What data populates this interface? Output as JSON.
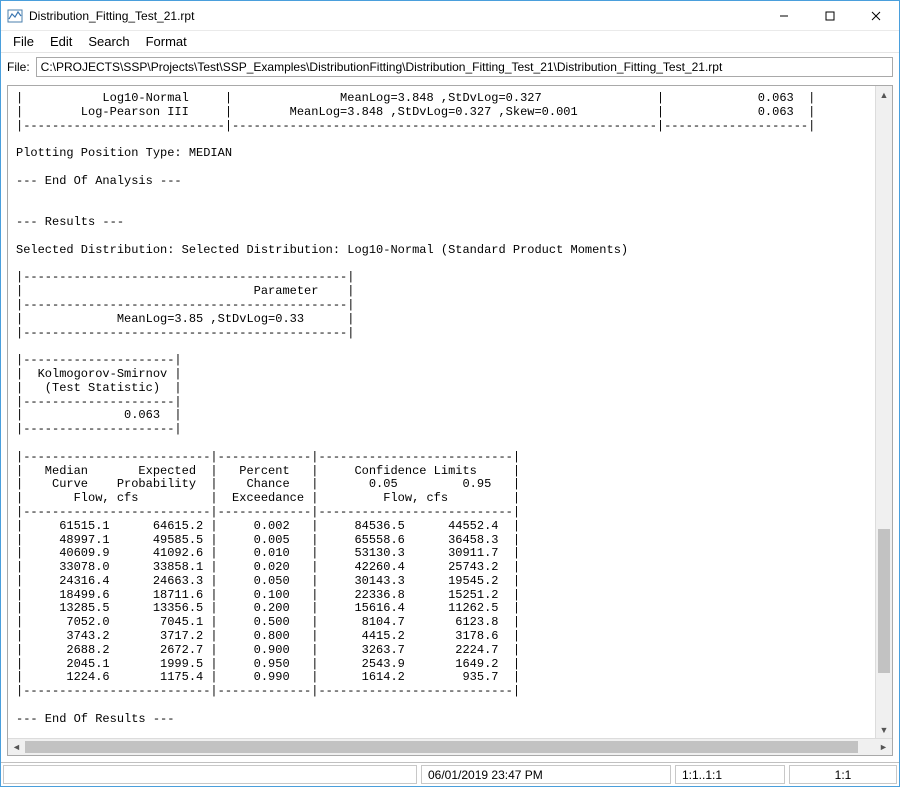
{
  "window": {
    "title": "Distribution_Fitting_Test_21.rpt"
  },
  "menubar": {
    "file": "File",
    "edit": "Edit",
    "search": "Search",
    "format": "Format"
  },
  "file_row": {
    "label": "File:",
    "path": "C:\\PROJECTS\\SSP\\Projects\\Test\\SSP_Examples\\DistributionFitting\\Distribution_Fitting_Test_21\\Distribution_Fitting_Test_21.rpt"
  },
  "report": {
    "top_lines": [
      "|           Log10-Normal     |               MeanLog=3.848 ,StDvLog=0.327                |             0.063  |",
      "|        Log-Pearson III     |        MeanLog=3.848 ,StDvLog=0.327 ,Skew=0.001           |             0.063  |",
      "|----------------------------|-----------------------------------------------------------|--------------------|"
    ],
    "plotting_position": "Plotting Position Type: MEDIAN",
    "end_analysis": "--- End Of Analysis ---",
    "results_header": "--- Results ---",
    "selected_dist": "Selected Distribution: Selected Distribution: Log10-Normal (Standard Product Moments)",
    "param_box": [
      "|---------------------------------------------|",
      "|                                Parameter    |",
      "|---------------------------------------------|",
      "|             MeanLog=3.85 ,StDvLog=0.33      |",
      "|---------------------------------------------|"
    ],
    "ks_box": [
      "|---------------------|",
      "|  Kolmogorov-Smirnov |",
      "|   (Test Statistic)  |",
      "|---------------------|",
      "|              0.063  |",
      "|---------------------|"
    ],
    "table_header": [
      "|--------------------------|-------------|---------------------------|",
      "|   Median       Expected  |   Percent   |     Confidence Limits     |",
      "|    Curve    Probability  |    Chance   |       0.05         0.95   |",
      "|       Flow, cfs          |  Exceedance |         Flow, cfs         |",
      "|--------------------------|-------------|---------------------------|"
    ],
    "table_rows": [
      "|     61515.1      64615.2 |     0.002   |     84536.5      44552.4  |",
      "|     48997.1      49585.5 |     0.005   |     65558.6      36458.3  |",
      "|     40609.9      41092.6 |     0.010   |     53130.3      30911.7  |",
      "|     33078.0      33858.1 |     0.020   |     42260.4      25743.2  |",
      "|     24316.4      24663.3 |     0.050   |     30143.3      19545.2  |",
      "|     18499.6      18711.6 |     0.100   |     22336.8      15251.2  |",
      "|     13285.5      13356.5 |     0.200   |     15616.4      11262.5  |",
      "|      7052.0       7045.1 |     0.500   |      8104.7       6123.8  |",
      "|      3743.2       3717.2 |     0.800   |      4415.2       3178.6  |",
      "|      2688.2       2672.7 |     0.900   |      3263.7       2224.7  |",
      "|      2045.1       1999.5 |     0.950   |      2543.9       1649.2  |",
      "|      1224.6       1175.4 |     0.990   |      1614.2        935.7  |"
    ],
    "table_footer": "|--------------------------|-------------|---------------------------|",
    "end_results": "--- End Of Results ---"
  },
  "statusbar": {
    "timestamp": "06/01/2019 23:47 PM",
    "selection": "1:1..1:1",
    "position": "1:1"
  }
}
